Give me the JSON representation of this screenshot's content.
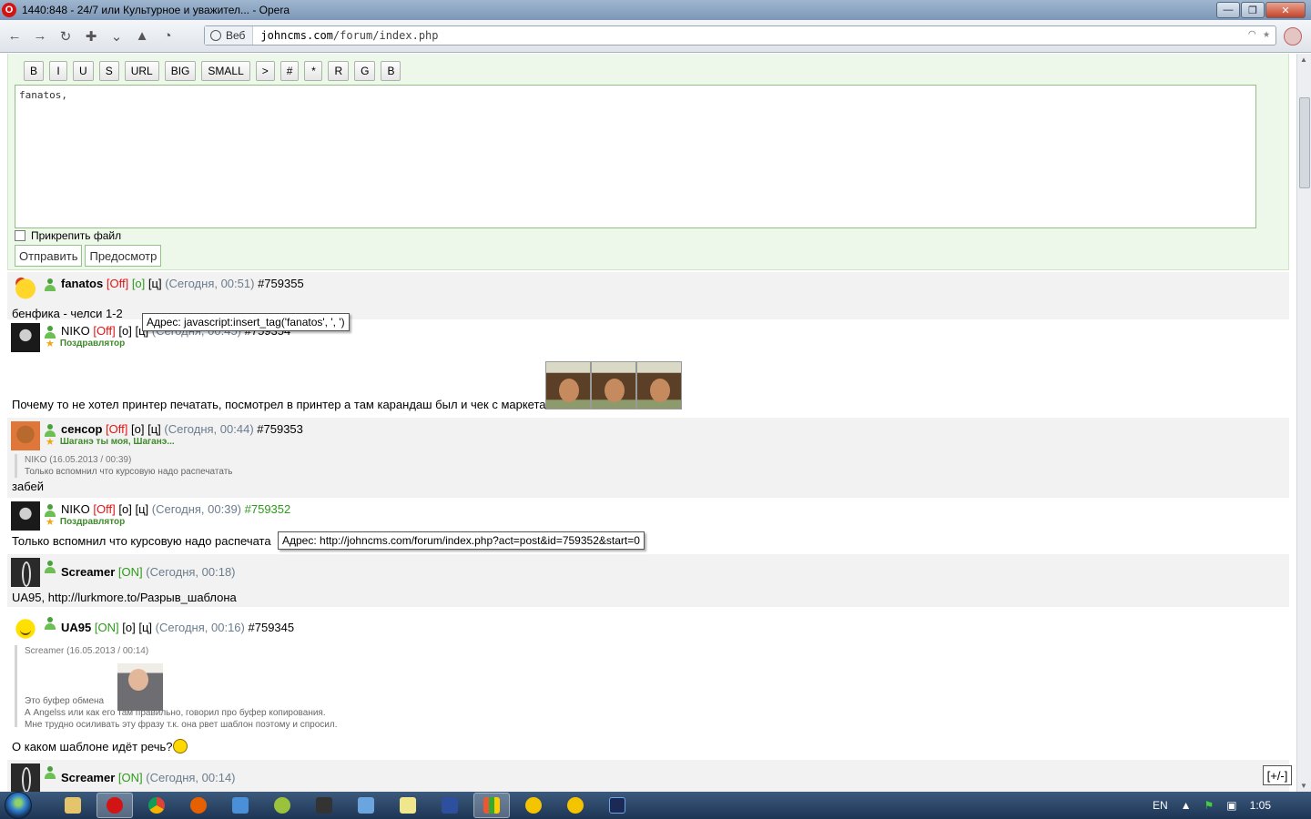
{
  "window": {
    "title": "1440:848 - 24/7 или Культурное и уважител... - Opera"
  },
  "browser": {
    "web_label": "Веб",
    "url_host": "johncms.com",
    "url_path": "/forum/index.php"
  },
  "reply_form": {
    "bbcode_buttons": [
      "B",
      "I",
      "U",
      "S",
      "URL",
      "BIG",
      "SMALL",
      ">",
      "#",
      "*",
      "R",
      "G",
      "B"
    ],
    "message_value": "fanatos,",
    "attach_label": "Прикрепить файл",
    "send_label": "Отправить",
    "preview_label": "Предосмотр"
  },
  "posts": [
    {
      "nick": "fanatos",
      "state": "[Off]",
      "o": "[о]",
      "c": "[ц]",
      "time": "(Сегодня, 00:51)",
      "id": "#759355",
      "text": "бенфика - челси 1-2"
    },
    {
      "nick": "NIKO",
      "state": "[Off]",
      "o": "[о]",
      "c": "[ц]",
      "time": "(Сегодня, 00:45)",
      "id": "#759354",
      "status": "Поздравлятор",
      "text": "Почему то не хотел принтер печатать, посмотрел в принтер а там карандаш был и чек с маркета"
    },
    {
      "nick": "сенсор",
      "state": "[Off]",
      "o": "[о]",
      "c": "[ц]",
      "time": "(Сегодня, 00:44)",
      "id": "#759353",
      "status": "Шаганэ ты моя, Шаганэ...",
      "quote_author": "NIKO (16.05.2013 / 00:39)",
      "quote_text": "Только вспомнил что курсовую надо распечатать",
      "text": "забей"
    },
    {
      "nick": "NIKO",
      "state": "[Off]",
      "o": "[о]",
      "c": "[ц]",
      "time": "(Сегодня, 00:39)",
      "id": "#759352",
      "status": "Поздравлятор",
      "text": "Только вспомнил что курсовую надо распечата"
    },
    {
      "nick": "Screamer",
      "state": "[ON]",
      "time": "(Сегодня, 00:18)",
      "text": "UA95, http://lurkmore.to/Разрыв_шаблона"
    },
    {
      "nick": "UA95",
      "state": "[ON]",
      "o": "[о]",
      "c": "[ц]",
      "time": "(Сегодня, 00:16)",
      "id": "#759345",
      "quote_author": "Screamer (16.05.2013 / 00:14)",
      "quote_line1": "Это буфер обмена",
      "quote_line2": "А Angelss или как его там правильно, говорил про буфер копирования.",
      "quote_line3": "Мне трудно осиливать эту фразу т.к. она рвет шаблон поэтому и спросил.",
      "text": "О каком шаблоне идёт речь?"
    },
    {
      "nick": "Screamer",
      "state": "[ON]",
      "time": "(Сегодня, 00:14)"
    }
  ],
  "tooltips": {
    "first": "Адрес: javascript:insert_tag('fanatos', ', ')",
    "second": "Адрес: http://johncms.com/forum/index.php?act=post&id=759352&start=0"
  },
  "toggle_label": "[+/-]",
  "taskbar": {
    "lang": "EN",
    "clock": "1:05"
  }
}
